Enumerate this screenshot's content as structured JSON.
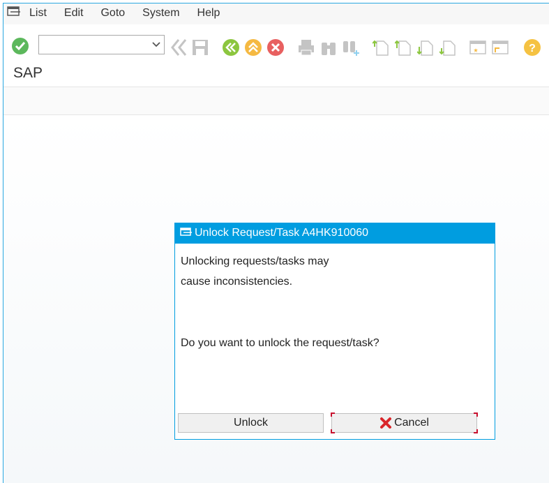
{
  "menubar": {
    "items": [
      {
        "label": "List"
      },
      {
        "label": "Edit"
      },
      {
        "label": "Goto"
      },
      {
        "label": "System"
      },
      {
        "label": "Help"
      }
    ]
  },
  "toolbar": {
    "command_field_value": ""
  },
  "title": "SAP",
  "dialog": {
    "title": "Unlock Request/Task A4HK910060",
    "line1": "Unlocking requests/tasks may",
    "line2": "cause inconsistencies.",
    "question": "Do you want to unlock the request/task?",
    "unlock_label": "Unlock",
    "cancel_label": "Cancel"
  },
  "colors": {
    "accent": "#009de0",
    "enter_green": "#5cb85c",
    "cancel_red": "#e04040",
    "focus_red": "#c8102e",
    "help_yellow": "#f0b429"
  }
}
